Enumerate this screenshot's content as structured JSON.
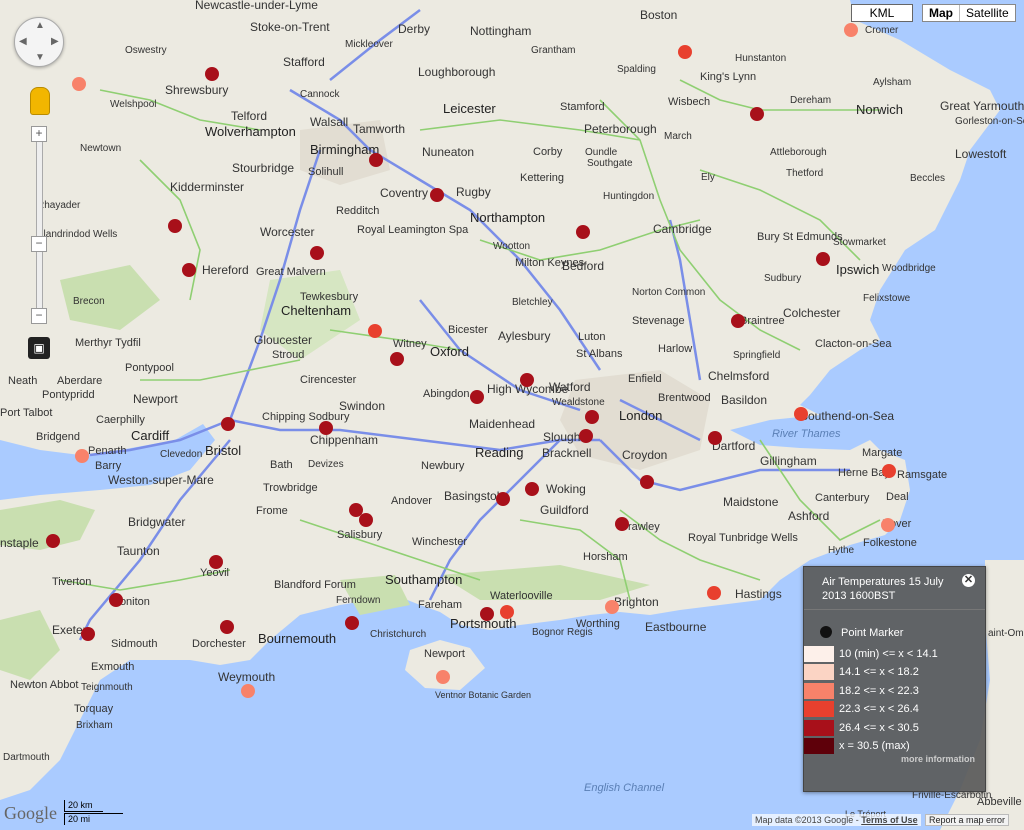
{
  "controls": {
    "kml_label": "KML",
    "map_label": "Map",
    "satellite_label": "Satellite",
    "zoom_in": "+",
    "zoom_out": "−"
  },
  "legend": {
    "title": "Air Temperatures 15 July 2013 1600BST",
    "close": "✕",
    "marker_label": "Point Marker",
    "items": [
      {
        "label": "10 (min) <= x < 14.1",
        "color": "#fdf0ea"
      },
      {
        "label": "14.1 <= x < 18.2",
        "color": "#fbd4c4"
      },
      {
        "label": "18.2 <= x < 22.3",
        "color": "#f8826a"
      },
      {
        "label": "22.3 <= x < 26.4",
        "color": "#e8402e"
      },
      {
        "label": "26.4 <= x < 30.5",
        "color": "#a8101a"
      },
      {
        "label": "x = 30.5 (max)",
        "color": "#5e000a"
      }
    ],
    "more_info": "more information"
  },
  "footer": {
    "google": "Google",
    "scale_km": "20 km",
    "scale_mi": "20 mi",
    "attribution_prefix": "Map data ©2013 Google -",
    "terms": "Terms of Use",
    "report": "Report a map error"
  },
  "places": {
    "newcastle": "Newcastle-under-Lyme",
    "stoke": "Stoke-on-Trent",
    "derby": "Derby",
    "nottingham": "Nottingham",
    "boston": "Boston",
    "cromer": "Cromer",
    "oswestry": "Oswestry",
    "stafford": "Stafford",
    "loughborough": "Loughborough",
    "grantham": "Grantham",
    "spalding": "Spalding",
    "kingslynn": "King's Lynn",
    "shrewsbury": "Shrewsbury",
    "cannock": "Cannock",
    "leicester": "Leicester",
    "stamford": "Stamford",
    "wisbech": "Wisbech",
    "dereham": "Dereham",
    "norwich": "Norwich",
    "telford": "Telford",
    "walsall": "Walsall",
    "tamworth": "Tamworth",
    "peterborough": "Peterborough",
    "greatyarmouth": "Great Yarmouth",
    "wolverhampton": "Wolverhampton",
    "birmingham": "Birmingham",
    "nuneaton": "Nuneaton",
    "corby": "Corby",
    "march": "March",
    "lowestoft": "Lowestoft",
    "stourbridge": "Stourbridge",
    "solihull": "Solihull",
    "kettering": "Kettering",
    "huntingdon": "Huntingdon",
    "thetford": "Thetford",
    "kidderminster": "Kidderminster",
    "coventry": "Coventry",
    "rugby": "Rugby",
    "ely": "Ely",
    "beccles": "Beccles",
    "redditch": "Redditch",
    "northampton": "Northampton",
    "newtown": "Newtown",
    "welshpool": "Welshpool",
    "worcester": "Worcester",
    "leamington": "Royal Leamington Spa",
    "cambridge": "Cambridge",
    "burystedmunds": "Bury St Edmunds",
    "stowmarket": "Stowmarket",
    "hereford": "Hereford",
    "greatmalvern": "Great Malvern",
    "wootton": "Wootton",
    "miltonkeynes": "Milton Keynes",
    "bedford": "Bedford",
    "ipswich": "Ipswich",
    "woodbridge": "Woodbridge",
    "tewkesbury": "Tewkesbury",
    "bletchley": "Bletchley",
    "nortoncommon": "Norton Common",
    "sudbury": "Sudbury",
    "felixstowe": "Felixstowe",
    "brecon": "Brecon",
    "cheltenham": "Cheltenham",
    "bicester": "Bicester",
    "aylesbury": "Aylesbury",
    "luton": "Luton",
    "stevenage": "Stevenage",
    "braintree": "Braintree",
    "colchester": "Colchester",
    "gloucester": "Gloucester",
    "witney": "Witney",
    "oxford": "Oxford",
    "stalbans": "St Albans",
    "harlow": "Harlow",
    "clacton": "Clacton-on-Sea",
    "merthyr": "Merthyr Tydfil",
    "stroud": "Stroud",
    "pontypool": "Pontypool",
    "springfield": "Springfield",
    "chelmsford": "Chelmsford",
    "neath": "Neath",
    "aberdare": "Aberdare",
    "cirencester": "Cirencester",
    "abingdon": "Abingdon",
    "highwycombe": "High Wycombe",
    "watford": "Watford",
    "enfield": "Enfield",
    "pontypridd": "Pontypridd",
    "newport": "Newport",
    "swindon": "Swindon",
    "wealdstone": "Wealdstone",
    "brentwood": "Brentwood",
    "basildon": "Basildon",
    "porttalbot": "Port Talbot",
    "caerphilly": "Caerphilly",
    "chipping": "Chipping Sodbury",
    "london": "London",
    "southend": "Southend-on-Sea",
    "bridgend": "Bridgend",
    "cardiff": "Cardiff",
    "chippenham": "Chippenham",
    "maidenhead": "Maidenhead",
    "slough": "Slough",
    "dartford": "Dartford",
    "margate": "Margate",
    "penarth": "Penarth",
    "bristol": "Bristol",
    "bath": "Bath",
    "newbury": "Newbury",
    "reading": "Reading",
    "bracknell": "Bracknell",
    "croydon": "Croydon",
    "gillingham": "Gillingham",
    "barry": "Barry",
    "clevedon": "Clevedon",
    "devizes": "Devizes",
    "hernebay": "Herne Bay",
    "ramsgate": "Ramsgate",
    "westonsupermare": "Weston-super-Mare",
    "trowbridge": "Trowbridge",
    "basingstoke": "Basingstoke",
    "woking": "Woking",
    "maidstone": "Maidstone",
    "canterbury": "Canterbury",
    "deal": "Deal",
    "andover": "Andover",
    "guildford": "Guildford",
    "ashford": "Ashford",
    "bridgwater": "Bridgwater",
    "frome": "Frome",
    "crawley": "Crawley",
    "dover": "Dover",
    "staple": "nstaple",
    "taunton": "Taunton",
    "salisbury": "Salisbury",
    "winchester": "Winchester",
    "horsham": "Horsham",
    "royaltunbridge": "Royal Tunbridge Wells",
    "hythe": "Hythe",
    "folkestone": "Folkestone",
    "tiverton": "Tiverton",
    "yeovil": "Yeovil",
    "blandford": "Blandford Forum",
    "southampton": "Southampton",
    "waterlooville": "Waterlooville",
    "exeter": "Exeter",
    "honiton": "Honiton",
    "ferndown": "Ferndown",
    "fareham": "Fareham",
    "brighton": "Brighton",
    "hastings": "Hastings",
    "sidmouth": "Sidmouth",
    "dorchester": "Dorchester",
    "bournemouth": "Bournemouth",
    "christchurch": "Christchurch",
    "portsmouth": "Portsmouth",
    "bognor": "Bognor Regis",
    "worthing": "Worthing",
    "eastbourne": "Eastbourne",
    "exmouth": "Exmouth",
    "weymouth": "Weymouth",
    "newportiow": "Newport",
    "teignmouth": "Teignmouth",
    "newtonabbot": "Newton Abbot",
    "ventnor": "Ventnor Botanic Garden",
    "torquay": "Torquay",
    "brixham": "Brixham",
    "dartmouth": "Dartmouth",
    "englishchannel": "English Channel",
    "rivertames": "River Thames",
    "gorleston": "Gorleston-on-Sea",
    "aylsham": "Aylsham",
    "hunstanton": "Hunstanton",
    "attleborough": "Attleborough",
    "southgate": "Southgate",
    "oundle": "Oundle",
    "rhayader": "Rhayader",
    "llandrindod": "Llandrindod Wells",
    "mickleover": "Mickleover",
    "friville": "Friville-Escarbotin",
    "abbeville": "Abbeville",
    "letreport": "Le Tréport",
    "tlaint": "aint-Om"
  }
}
